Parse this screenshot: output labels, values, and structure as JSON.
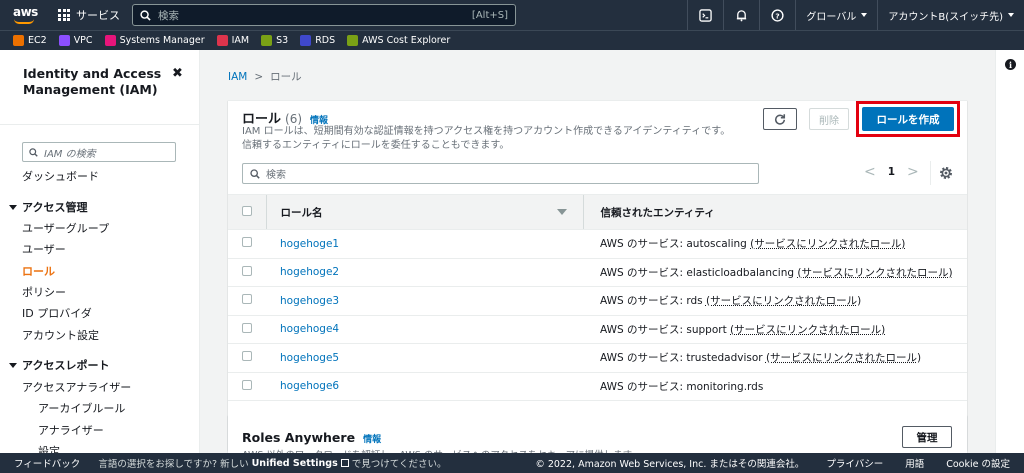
{
  "topnav": {
    "logo_text": "aws",
    "services_label": "サービス",
    "search_placeholder": "検索",
    "search_shortcut": "[Alt+S]",
    "region_label": "グローバル",
    "account_label": "アカウントB(スイッチ先)"
  },
  "favorites": [
    {
      "label": "EC2",
      "color": "#ed7100"
    },
    {
      "label": "VPC",
      "color": "#8c4fff"
    },
    {
      "label": "Systems Manager",
      "color": "#e7157b"
    },
    {
      "label": "IAM",
      "color": "#dd344c"
    },
    {
      "label": "S3",
      "color": "#7aa116"
    },
    {
      "label": "RDS",
      "color": "#3f48cc"
    },
    {
      "label": "AWS Cost Explorer",
      "color": "#7aa116"
    }
  ],
  "sidebar": {
    "title": "Identity and Access Management (IAM)",
    "close": "✖",
    "search_placeholder": "IAM の検索",
    "dashboard": "ダッシュボード",
    "section_access_mgmt": "アクセス管理",
    "items": [
      "ユーザーグループ",
      "ユーザー",
      "ロール",
      "ポリシー",
      "ID プロバイダ",
      "アカウント設定"
    ],
    "section_access_reports": "アクセスレポート",
    "report_items": [
      "アクセスアナライザー"
    ],
    "report_sub_items": [
      "アーカイブルール",
      "アナライザー",
      "設定"
    ]
  },
  "breadcrumb": {
    "root": "IAM",
    "separator": ">",
    "current": "ロール"
  },
  "roles_panel": {
    "title": "ロール",
    "count": "(6)",
    "info": "情報",
    "description": "IAM ロールは、短期間有効な認証情報を持つアクセス権を持つアカウント作成できるアイデンティティです。信頼するエンティティにロールを委任することもできます。",
    "delete_label": "削除",
    "create_label": "ロールを作成",
    "search_placeholder": "検索",
    "page_prev": "<",
    "page_number": "1",
    "page_next": ">",
    "columns": [
      "ロール名",
      "信頼されたエンティティ"
    ],
    "rows": [
      {
        "name": "hogehoge1",
        "entity_prefix": "AWS のサービス: autoscaling ",
        "entity_link": "(サービスにリンクされたロール)"
      },
      {
        "name": "hogehoge2",
        "entity_prefix": "AWS のサービス: elasticloadbalancing ",
        "entity_link": "(サービスにリンクされたロール)"
      },
      {
        "name": "hogehoge3",
        "entity_prefix": "AWS のサービス: rds ",
        "entity_link": "(サービスにリンクされたロール)"
      },
      {
        "name": "hogehoge4",
        "entity_prefix": "AWS のサービス: support ",
        "entity_link": "(サービスにリンクされたロール)"
      },
      {
        "name": "hogehoge5",
        "entity_prefix": "AWS のサービス: trustedadvisor ",
        "entity_link": "(サービスにリンクされたロール)"
      },
      {
        "name": "hogehoge6",
        "entity_prefix": "AWS のサービス: monitoring.rds",
        "entity_link": ""
      }
    ]
  },
  "roles_anywhere": {
    "title": "Roles Anywhere",
    "info": "情報",
    "description": "AWS 以外のワークロードを認証し、AWS のサービスへのアクセスをセキュアに提供します。",
    "manage_label": "管理"
  },
  "footer": {
    "feedback": "フィードバック",
    "lang_prompt": "言語の選択をお探しですか? 新しい",
    "lang_link": "Unified Settings",
    "lang_suffix": "で見つけてください。",
    "copyright": "© 2022, Amazon Web Services, Inc. またはその関連会社。",
    "privacy": "プライバシー",
    "terms": "用語",
    "cookies": "Cookie の設定"
  }
}
